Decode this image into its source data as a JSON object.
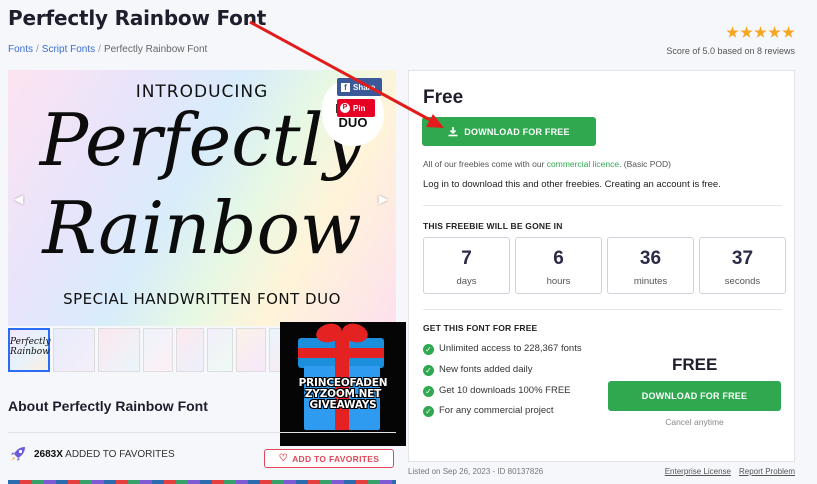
{
  "page": {
    "title": "Perfectly Rainbow Font"
  },
  "breadcrumb": {
    "items": [
      "Fonts",
      "Script Fonts",
      "Perfectly Rainbow Font"
    ],
    "separator": "/"
  },
  "rating": {
    "stars": 5,
    "score_text": "Score of 5.0 based on 8 reviews",
    "star_color": "#f5a623"
  },
  "hero": {
    "line1": "INTRODUCING",
    "line2": "Perfectly",
    "line3": "Rainbow",
    "line4": "SPECIAL HANDWRITTEN FONT DUO",
    "badge_text": "FONT DUO",
    "share_label": "Share",
    "pin_label": "Pin",
    "prev_icon": "chevron-left-icon",
    "next_icon": "chevron-right-icon"
  },
  "thumbnails": {
    "count": 9,
    "selected_index": 0,
    "selected_text": "Perfectly Rainbow"
  },
  "gift_overlay": {
    "text": "PRINCEOFADEN ZYZOOM.NET GIVEAWAYS"
  },
  "about": {
    "heading": "About Perfectly Rainbow Font"
  },
  "favorites": {
    "count": "2683X",
    "label": "ADDED TO FAVORITES",
    "button_label": "ADD TO FAVORITES"
  },
  "panel": {
    "price": "Free",
    "download_label": "DOWNLOAD FOR FREE",
    "licence_prefix": "All of our freebies come with our ",
    "licence_link": "commercial licence",
    "licence_suffix": ". (Basic POD)",
    "login_text": "Log in to download this and other freebies. Creating an account is free.",
    "gone_heading": "THIS FREEBIE WILL BE GONE IN",
    "countdown": [
      {
        "value": "7",
        "unit": "days"
      },
      {
        "value": "6",
        "unit": "hours"
      },
      {
        "value": "36",
        "unit": "minutes"
      },
      {
        "value": "37",
        "unit": "seconds"
      }
    ],
    "get_heading": "GET THIS FONT FOR FREE",
    "features": [
      "Unlimited access to 228,367 fonts",
      "New fonts added daily",
      "Get 10 downloads 100% FREE",
      "For any commercial project"
    ],
    "free_big": "FREE",
    "download_label_2": "DOWNLOAD FOR FREE",
    "cancel_text": "Cancel anytime",
    "accent_color": "#2fa84f"
  },
  "footer": {
    "listed": "Listed on Sep 26, 2023 - ID 80137826",
    "links": [
      "Enterprise License",
      "Report Problem"
    ]
  }
}
